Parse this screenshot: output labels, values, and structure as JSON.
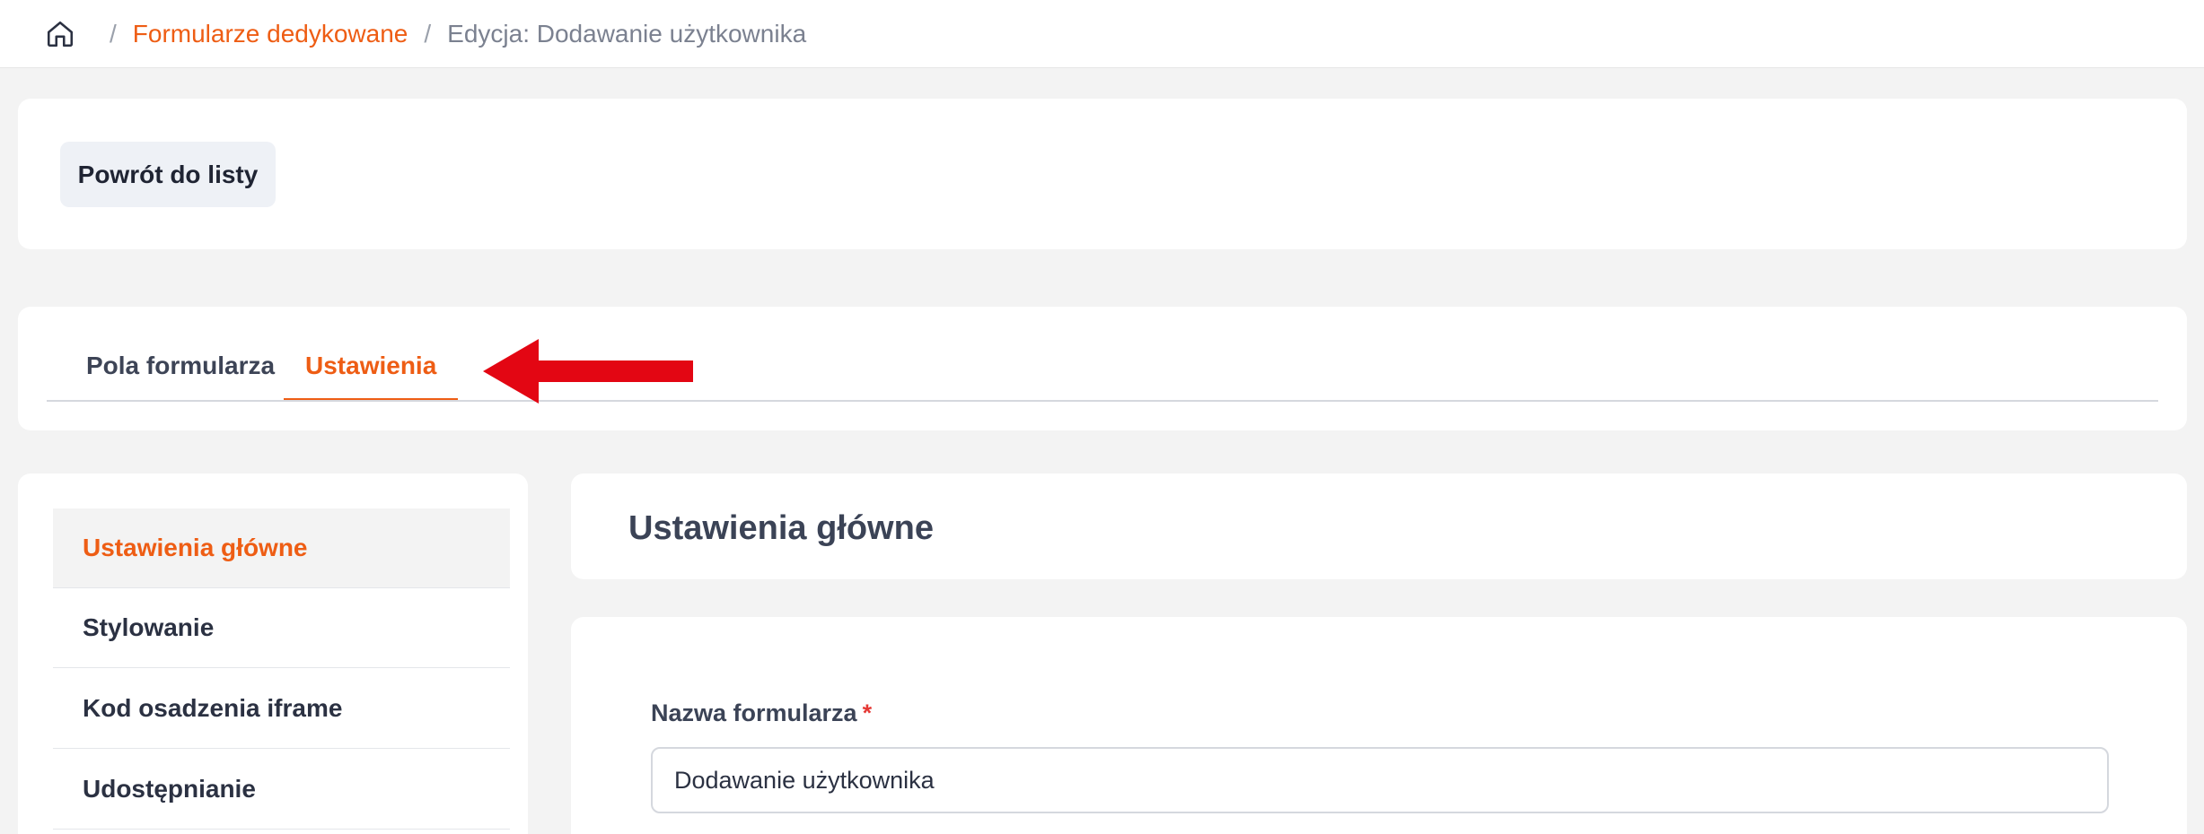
{
  "breadcrumb": {
    "home_icon": "home-icon",
    "separator": "/",
    "link": "Formularze dedykowane",
    "current": "Edycja: Dodawanie użytkownika"
  },
  "back_button": {
    "label": "Powrót do listy"
  },
  "tabs": [
    {
      "label": "Pola formularza",
      "active": false
    },
    {
      "label": "Ustawienia",
      "active": true
    }
  ],
  "annotation": {
    "arrow_color": "#e30613",
    "arrow_icon": "left-arrow-annotation"
  },
  "sidebar": {
    "items": [
      {
        "label": "Ustawienia główne",
        "active": true
      },
      {
        "label": "Stylowanie",
        "active": false
      },
      {
        "label": "Kod osadzenia iframe",
        "active": false
      },
      {
        "label": "Udostępnianie",
        "active": false
      }
    ]
  },
  "main": {
    "title": "Ustawienia główne",
    "form": {
      "name_label": "Nazwa formularza",
      "required_mark": "*",
      "name_value": "Dodawanie użytkownika"
    }
  },
  "colors": {
    "accent": "#ee5d14",
    "required": "#e53935",
    "background": "#f3f3f3"
  }
}
